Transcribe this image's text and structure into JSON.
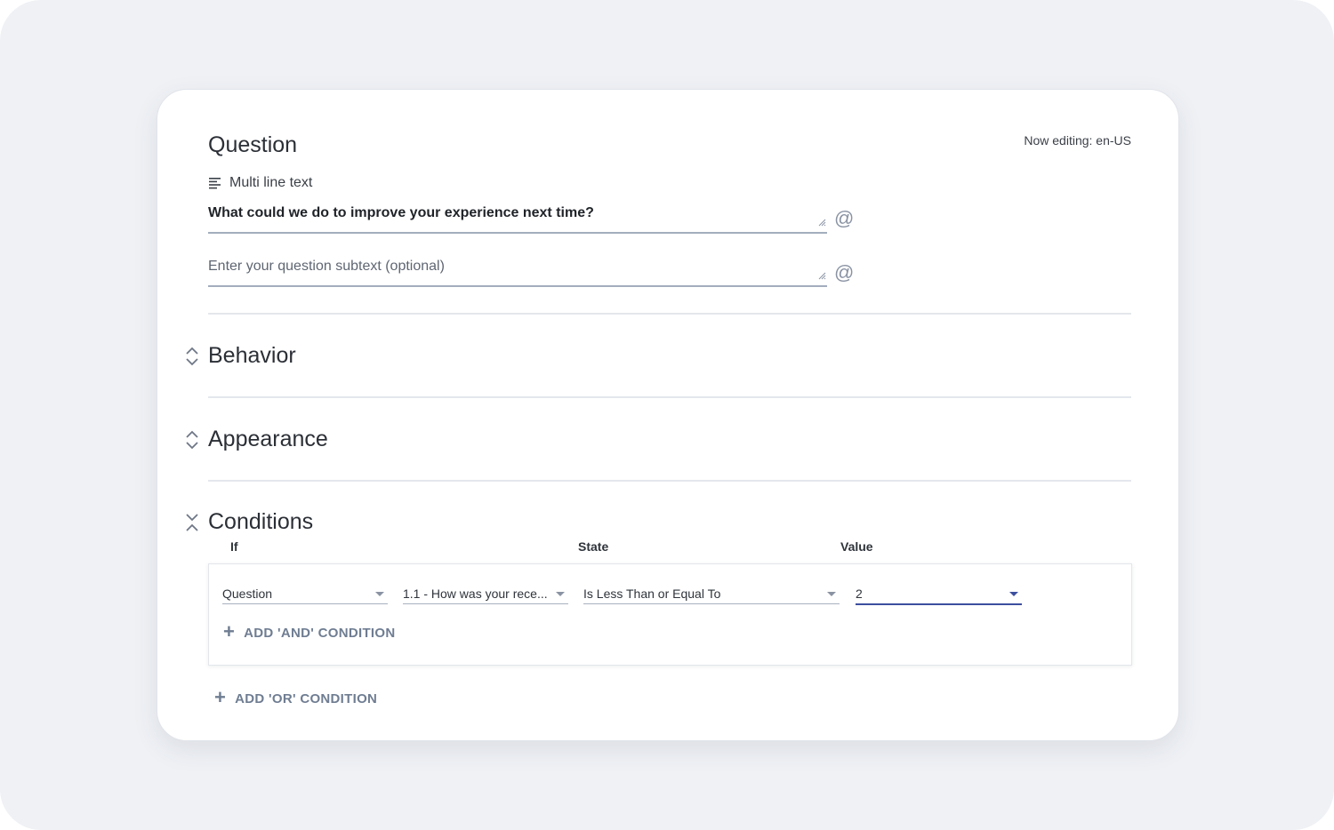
{
  "header": {
    "title": "Question",
    "now_editing": "Now editing: en-US"
  },
  "question": {
    "type_icon": "multiline-text-icon",
    "type_label": "Multi line text",
    "text_value": "What could we do to improve your experience next time?",
    "subtext_placeholder": "Enter your question subtext (optional)",
    "mention_symbol": "@"
  },
  "sections": {
    "behavior": "Behavior",
    "appearance": "Appearance",
    "conditions": "Conditions"
  },
  "conditions": {
    "columns": {
      "if": "If",
      "state": "State",
      "value": "Value"
    },
    "row": {
      "source": "Question",
      "question": "1.1 - How was your rece...",
      "state": "Is Less Than or Equal To",
      "value": "2"
    },
    "add_and": "ADD 'AND' CONDITION",
    "add_or": "ADD 'OR' CONDITION"
  },
  "colors": {
    "accent": "#3c4f9f",
    "link": "#6f7d92",
    "backdrop": "#eff1f5"
  }
}
